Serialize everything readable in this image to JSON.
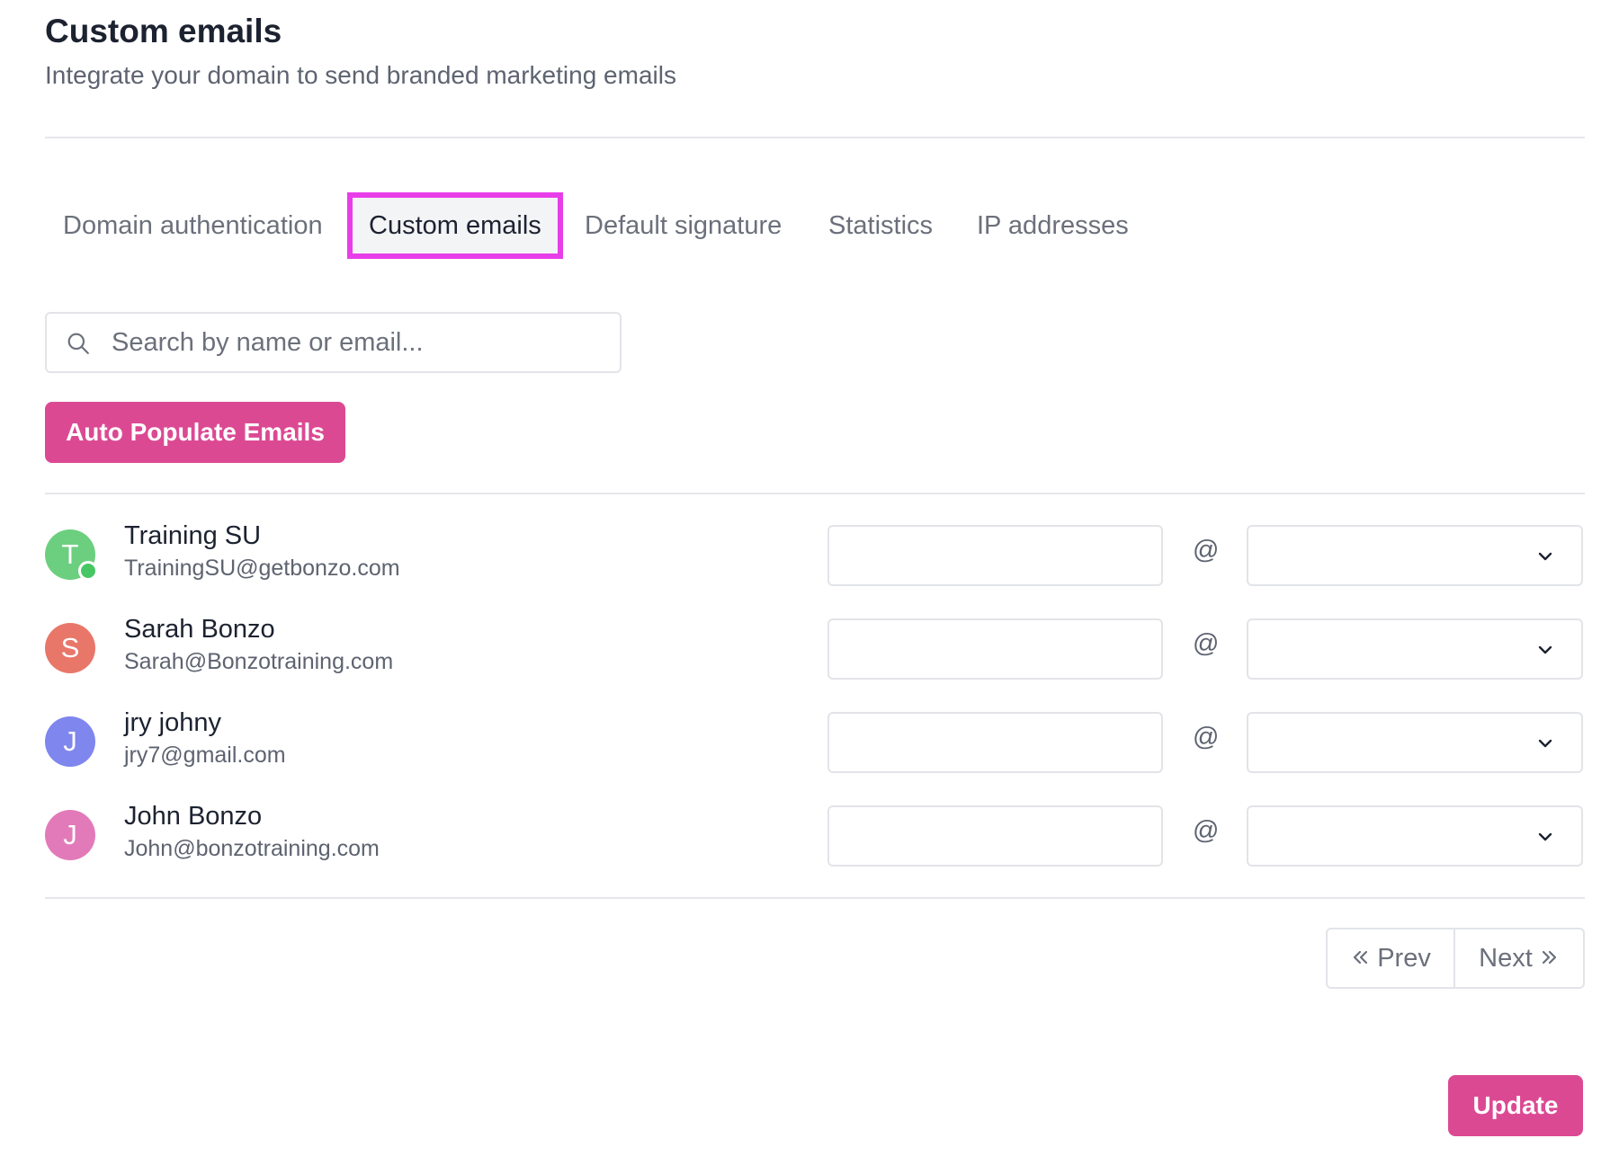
{
  "header": {
    "title": "Custom emails",
    "subtitle": "Integrate your domain to send branded marketing emails"
  },
  "tabs": [
    {
      "label": "Domain authentication",
      "active": false
    },
    {
      "label": "Custom emails",
      "active": true
    },
    {
      "label": "Default signature",
      "active": false
    },
    {
      "label": "Statistics",
      "active": false
    },
    {
      "label": "IP addresses",
      "active": false
    }
  ],
  "search": {
    "placeholder": "Search by name or email...",
    "value": "",
    "icon": "search-icon"
  },
  "actions": {
    "auto_populate_label": "Auto Populate Emails",
    "update_label": "Update"
  },
  "users": [
    {
      "initial": "T",
      "name": "Training SU",
      "email": "TrainingSU@getbonzo.com",
      "avatar_color": "#6ccf7f",
      "online": true,
      "prefix": "",
      "domain": ""
    },
    {
      "initial": "S",
      "name": "Sarah Bonzo",
      "email": "Sarah@Bonzotraining.com",
      "avatar_color": "#e8776a",
      "online": false,
      "prefix": "",
      "domain": ""
    },
    {
      "initial": "J",
      "name": "jry johny",
      "email": "jry7@gmail.com",
      "avatar_color": "#7f86ee",
      "online": false,
      "prefix": "",
      "domain": ""
    },
    {
      "initial": "J",
      "name": "John Bonzo",
      "email": "John@bonzotraining.com",
      "avatar_color": "#e27ab9",
      "online": false,
      "prefix": "",
      "domain": ""
    }
  ],
  "at_symbol": "@",
  "pagination": {
    "prev_label": "Prev",
    "next_label": "Next"
  },
  "colors": {
    "accent": "#dc4993",
    "active_tab_border": "#e83ee9",
    "online": "#47c763"
  }
}
